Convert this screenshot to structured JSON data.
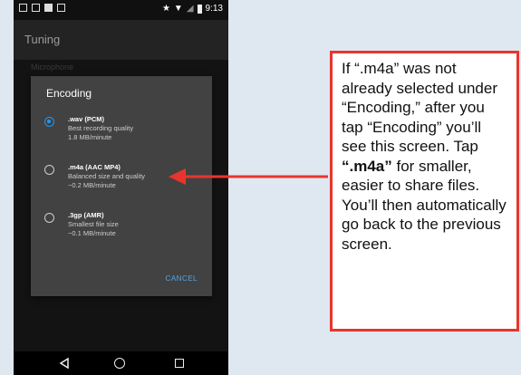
{
  "status_bar": {
    "time": "9:13",
    "left_icons": [
      "image-icon",
      "message-icon",
      "share-icon",
      "check-box-icon"
    ],
    "right_icons": [
      "star-icon",
      "wifi-icon",
      "signal-icon",
      "battery-icon"
    ]
  },
  "app_bar": {
    "title": "Tuning"
  },
  "background_item": "Microphone",
  "dialog": {
    "title": "Encoding",
    "options": [
      {
        "name": ".wav (PCM)",
        "desc": "Best recording quality",
        "size": "1.8 MB/minute",
        "selected": true
      },
      {
        "name": ".m4a (AAC MP4)",
        "desc": "Balanced size and quality",
        "size": "~0.2 MB/minute",
        "selected": false
      },
      {
        "name": ".3gp (AMR)",
        "desc": "Smallest file size",
        "size": "~0.1 MB/minute",
        "selected": false
      }
    ],
    "cancel_label": "CANCEL"
  },
  "nav": {
    "back": "◁",
    "home": "○",
    "recent": "□"
  },
  "callout": {
    "text_1": "If “.m4a” was not already selected under “Encoding,” after you tap “Encoding” you’ll see this screen. Tap ",
    "bold": "“.m4a”",
    "text_2": " for smaller, easier to share files. You’ll then automatically go back to the previous screen."
  },
  "colors": {
    "accent": "#2196f3",
    "callout_border": "#e8352b",
    "arrow": "#e8352b"
  }
}
